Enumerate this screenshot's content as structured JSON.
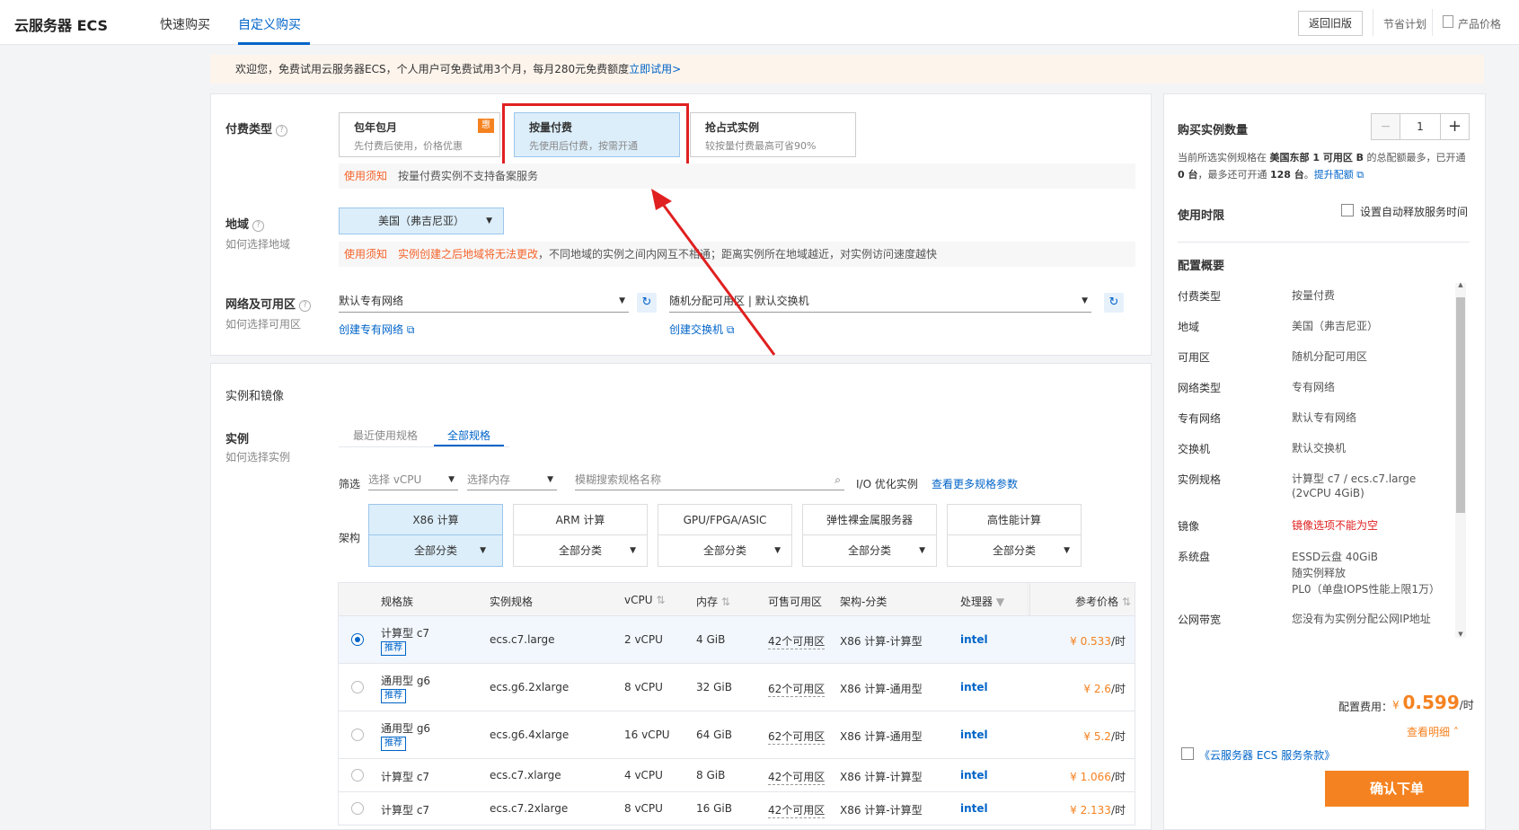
{
  "header": {
    "logo": "云服务器 ECS",
    "tabs": [
      "快速购买",
      "自定义购买"
    ],
    "active_tab": "自定义购买",
    "old_version": "返回旧版",
    "save_plan": "节省计划",
    "product_price": "产品价格"
  },
  "notice": {
    "text": "欢迎您，免费试用云服务器ECS，个人用户可免费试用3个月，每月280元免费额度",
    "link": "立即试用>"
  },
  "billing": {
    "label": "付费类型",
    "options": [
      {
        "title": "包年包月",
        "desc": "先付费后使用，价格优惠",
        "badge": "惠"
      },
      {
        "title": "按量付费",
        "desc": "先使用后付费，按需开通"
      },
      {
        "title": "抢占式实例",
        "desc": "较按量付费最高可省90%"
      }
    ],
    "selected": "按量付费",
    "tip_label": "使用须知",
    "tip_text": "按量付费实例不支持备案服务"
  },
  "region": {
    "label": "地域",
    "help": "如何选择地域",
    "value": "美国（弗吉尼亚）",
    "tip_label": "使用须知",
    "tip_red": "实例创建之后地域将无法更改",
    "tip_text": "，不同地域的实例之间内网互不相通；距离实例所在地域越近，对实例访问速度越快"
  },
  "network": {
    "label": "网络及可用区",
    "help": "如何选择可用区",
    "vpc": "默认专有网络",
    "zone": "随机分配可用区 | 默认交换机",
    "create_vpc": "创建专有网络",
    "create_switch": "创建交换机"
  },
  "instance_section": {
    "title": "实例和镜像",
    "label": "实例",
    "help": "如何选择实例",
    "subtabs": [
      "最近使用规格",
      "全部规格"
    ],
    "active_subtab": "全部规格",
    "filter_label": "筛选",
    "vcpu_placeholder": "选择 vCPU",
    "mem_placeholder": "选择内存",
    "search_placeholder": "模糊搜索规格名称",
    "io_opt": "I/O 优化实例",
    "more_params": "查看更多规格参数",
    "arch_label": "架构",
    "archs": [
      {
        "name": "X86 计算",
        "sub": "全部分类"
      },
      {
        "name": "ARM 计算",
        "sub": "全部分类"
      },
      {
        "name": "GPU/FPGA/ASIC",
        "sub": "全部分类"
      },
      {
        "name": "弹性裸金属服务器",
        "sub": "全部分类"
      },
      {
        "name": "高性能计算",
        "sub": "全部分类"
      }
    ]
  },
  "table": {
    "headers": [
      "规格族",
      "实例规格",
      "vCPU",
      "内存",
      "可售可用区",
      "架构-分类",
      "处理器",
      "参考价格"
    ],
    "recommend": "推荐",
    "rows": [
      {
        "family": "计算型 c7",
        "spec": "ecs.c7.large",
        "vcpu": "2 vCPU",
        "mem": "4 GiB",
        "zones": "42个可用区",
        "arch": "X86 计算-计算型",
        "cpu": "intel",
        "price": "¥ 0.533",
        "unit": "/时",
        "rec": true
      },
      {
        "family": "通用型 g6",
        "spec": "ecs.g6.2xlarge",
        "vcpu": "8 vCPU",
        "mem": "32 GiB",
        "zones": "62个可用区",
        "arch": "X86 计算-通用型",
        "cpu": "intel",
        "price": "¥ 2.6",
        "unit": "/时",
        "rec": true
      },
      {
        "family": "通用型 g6",
        "spec": "ecs.g6.4xlarge",
        "vcpu": "16 vCPU",
        "mem": "64 GiB",
        "zones": "62个可用区",
        "arch": "X86 计算-通用型",
        "cpu": "intel",
        "price": "¥ 5.2",
        "unit": "/时",
        "rec": true
      },
      {
        "family": "计算型 c7",
        "spec": "ecs.c7.xlarge",
        "vcpu": "4 vCPU",
        "mem": "8 GiB",
        "zones": "42个可用区",
        "arch": "X86 计算-计算型",
        "cpu": "intel",
        "price": "¥ 1.066",
        "unit": "/时",
        "rec": false
      },
      {
        "family": "计算型 c7",
        "spec": "ecs.c7.2xlarge",
        "vcpu": "8 vCPU",
        "mem": "16 GiB",
        "zones": "42个可用区",
        "arch": "X86 计算-计算型",
        "cpu": "intel",
        "price": "¥ 2.133",
        "unit": "/时",
        "rec": false
      }
    ]
  },
  "right": {
    "qty_label": "购买实例数量",
    "qty": "1",
    "qty_note1": "当前所选实例规格在",
    "qty_note_bold": "美国东部 1 可用区 B",
    "qty_note2": "的总配额最多，已开通",
    "qty_opened": "0 台",
    "qty_note3": "，最多还可开通",
    "qty_max": "128 台",
    "qty_note4": "。",
    "quota_link": "提升配额",
    "duration_label": "使用时限",
    "auto_release": "设置自动释放服务时间",
    "summary_title": "配置概要",
    "summary": [
      {
        "k": "付费类型",
        "v": "按量付费"
      },
      {
        "k": "地域",
        "v": "美国（弗吉尼亚）"
      },
      {
        "k": "可用区",
        "v": "随机分配可用区"
      },
      {
        "k": "网络类型",
        "v": "专有网络"
      },
      {
        "k": "专有网络",
        "v": "默认专有网络"
      },
      {
        "k": "交换机",
        "v": "默认交换机"
      },
      {
        "k": "实例规格",
        "v": "计算型 c7 / ecs.c7.large (2vCPU 4GiB)"
      },
      {
        "k": "镜像",
        "v": "镜像选项不能为空"
      },
      {
        "k": "系统盘",
        "v": "ESSD云盘 40GiB\n随实例释放\nPL0（单盘IOPS性能上限1万）"
      },
      {
        "k": "公网带宽",
        "v": "您没有为实例分配公网IP地址"
      }
    ],
    "fee_label": "配置费用：",
    "fee_currency": "¥",
    "fee_value": "0.599",
    "fee_unit": "/时",
    "detail_link": "查看明细",
    "terms": "《云服务器 ECS 服务条款》",
    "confirm": "确认下单"
  },
  "colors": {
    "brand": "#0064c8",
    "accent": "#f58220",
    "highlight": "#e02020"
  }
}
